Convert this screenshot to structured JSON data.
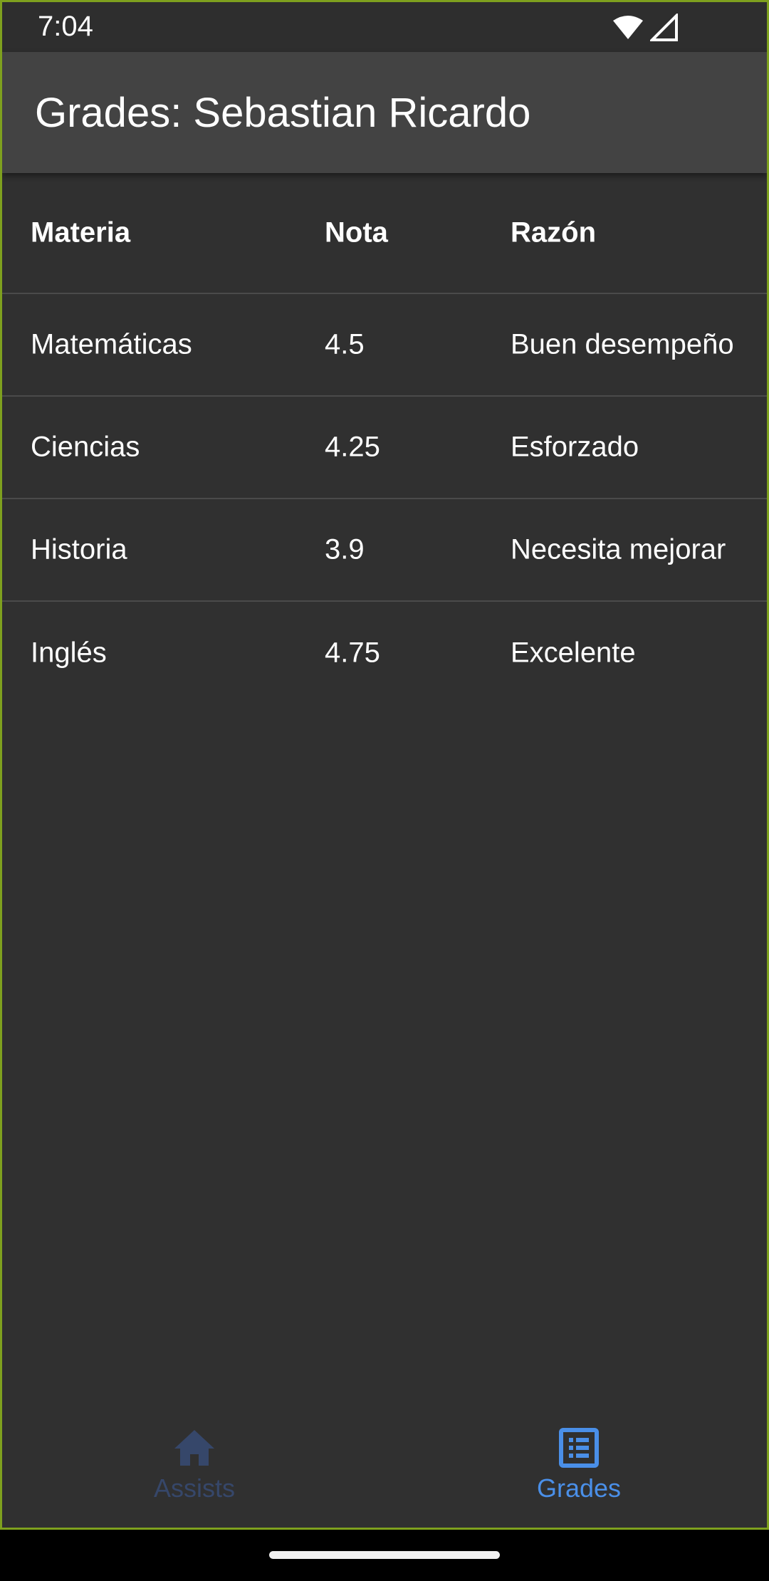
{
  "status_bar": {
    "time": "7:04",
    "icons": [
      "wifi-icon",
      "signal-icon"
    ]
  },
  "app_bar": {
    "title": "Grades: Sebastian Ricardo"
  },
  "table": {
    "headers": [
      "Materia",
      "Nota",
      "Razón"
    ],
    "rows": [
      [
        "Matemáticas",
        "4.5",
        "Buen desempeño"
      ],
      [
        "Ciencias",
        "4.25",
        "Esforzado"
      ],
      [
        "Historia",
        "3.9",
        "Necesita mejorar"
      ],
      [
        "Inglés",
        "4.75",
        "Excelente"
      ]
    ]
  },
  "bottom_nav": {
    "items": [
      {
        "label": "Assists",
        "icon": "home-icon",
        "selected": false
      },
      {
        "label": "Grades",
        "icon": "list-icon",
        "selected": true
      }
    ]
  },
  "colors": {
    "background": "#303030",
    "app_bar": "#434343",
    "accent": "#4a8fe8",
    "inactive": "#36476a",
    "frame": "#7ea01e"
  }
}
